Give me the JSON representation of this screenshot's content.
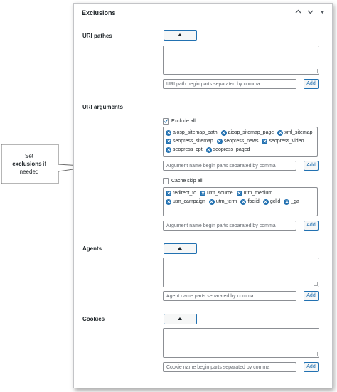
{
  "panel": {
    "title": "Exclusions"
  },
  "header_icons": [
    "chevron-up-icon",
    "chevron-down-icon",
    "triangle-down-icon"
  ],
  "sections": {
    "uri_pathes": {
      "label": "URI pathes",
      "input_placeholder": "URI path begin parts separated by comma",
      "add_label": "Add"
    },
    "uri_arguments": {
      "label": "URI arguments",
      "exclude_all_label": "Exclude all",
      "exclude_all_checked": true,
      "exclude_tags": [
        "aiosp_sitemap_path",
        "aiosp_sitemap_page",
        "xml_sitemap",
        "seopress_sitemap",
        "seopress_news",
        "seopress_video",
        "seopress_cpt",
        "seopress_paged"
      ],
      "exclude_input_placeholder": "Argument name begin parts separated by comma",
      "add_label": "Add",
      "cache_skip_all_label": "Cache skip all",
      "cache_skip_all_checked": false,
      "skip_tags": [
        "redirect_to",
        "utm_source",
        "utm_medium",
        "utm_campaign",
        "utm_term",
        "fbclid",
        "gclid",
        "_ga"
      ],
      "skip_input_placeholder": "Argument name begin parts separated by comma"
    },
    "agents": {
      "label": "Agents",
      "input_placeholder": "Agent name parts separated by comma",
      "add_label": "Add"
    },
    "cookies": {
      "label": "Cookies",
      "input_placeholder": "Cookie name begin parts separated by comma",
      "add_label": "Add"
    }
  },
  "callout": {
    "line1": "Set",
    "line2_bold": "exclusions",
    "line2_rest": " if",
    "line3": "needed"
  }
}
